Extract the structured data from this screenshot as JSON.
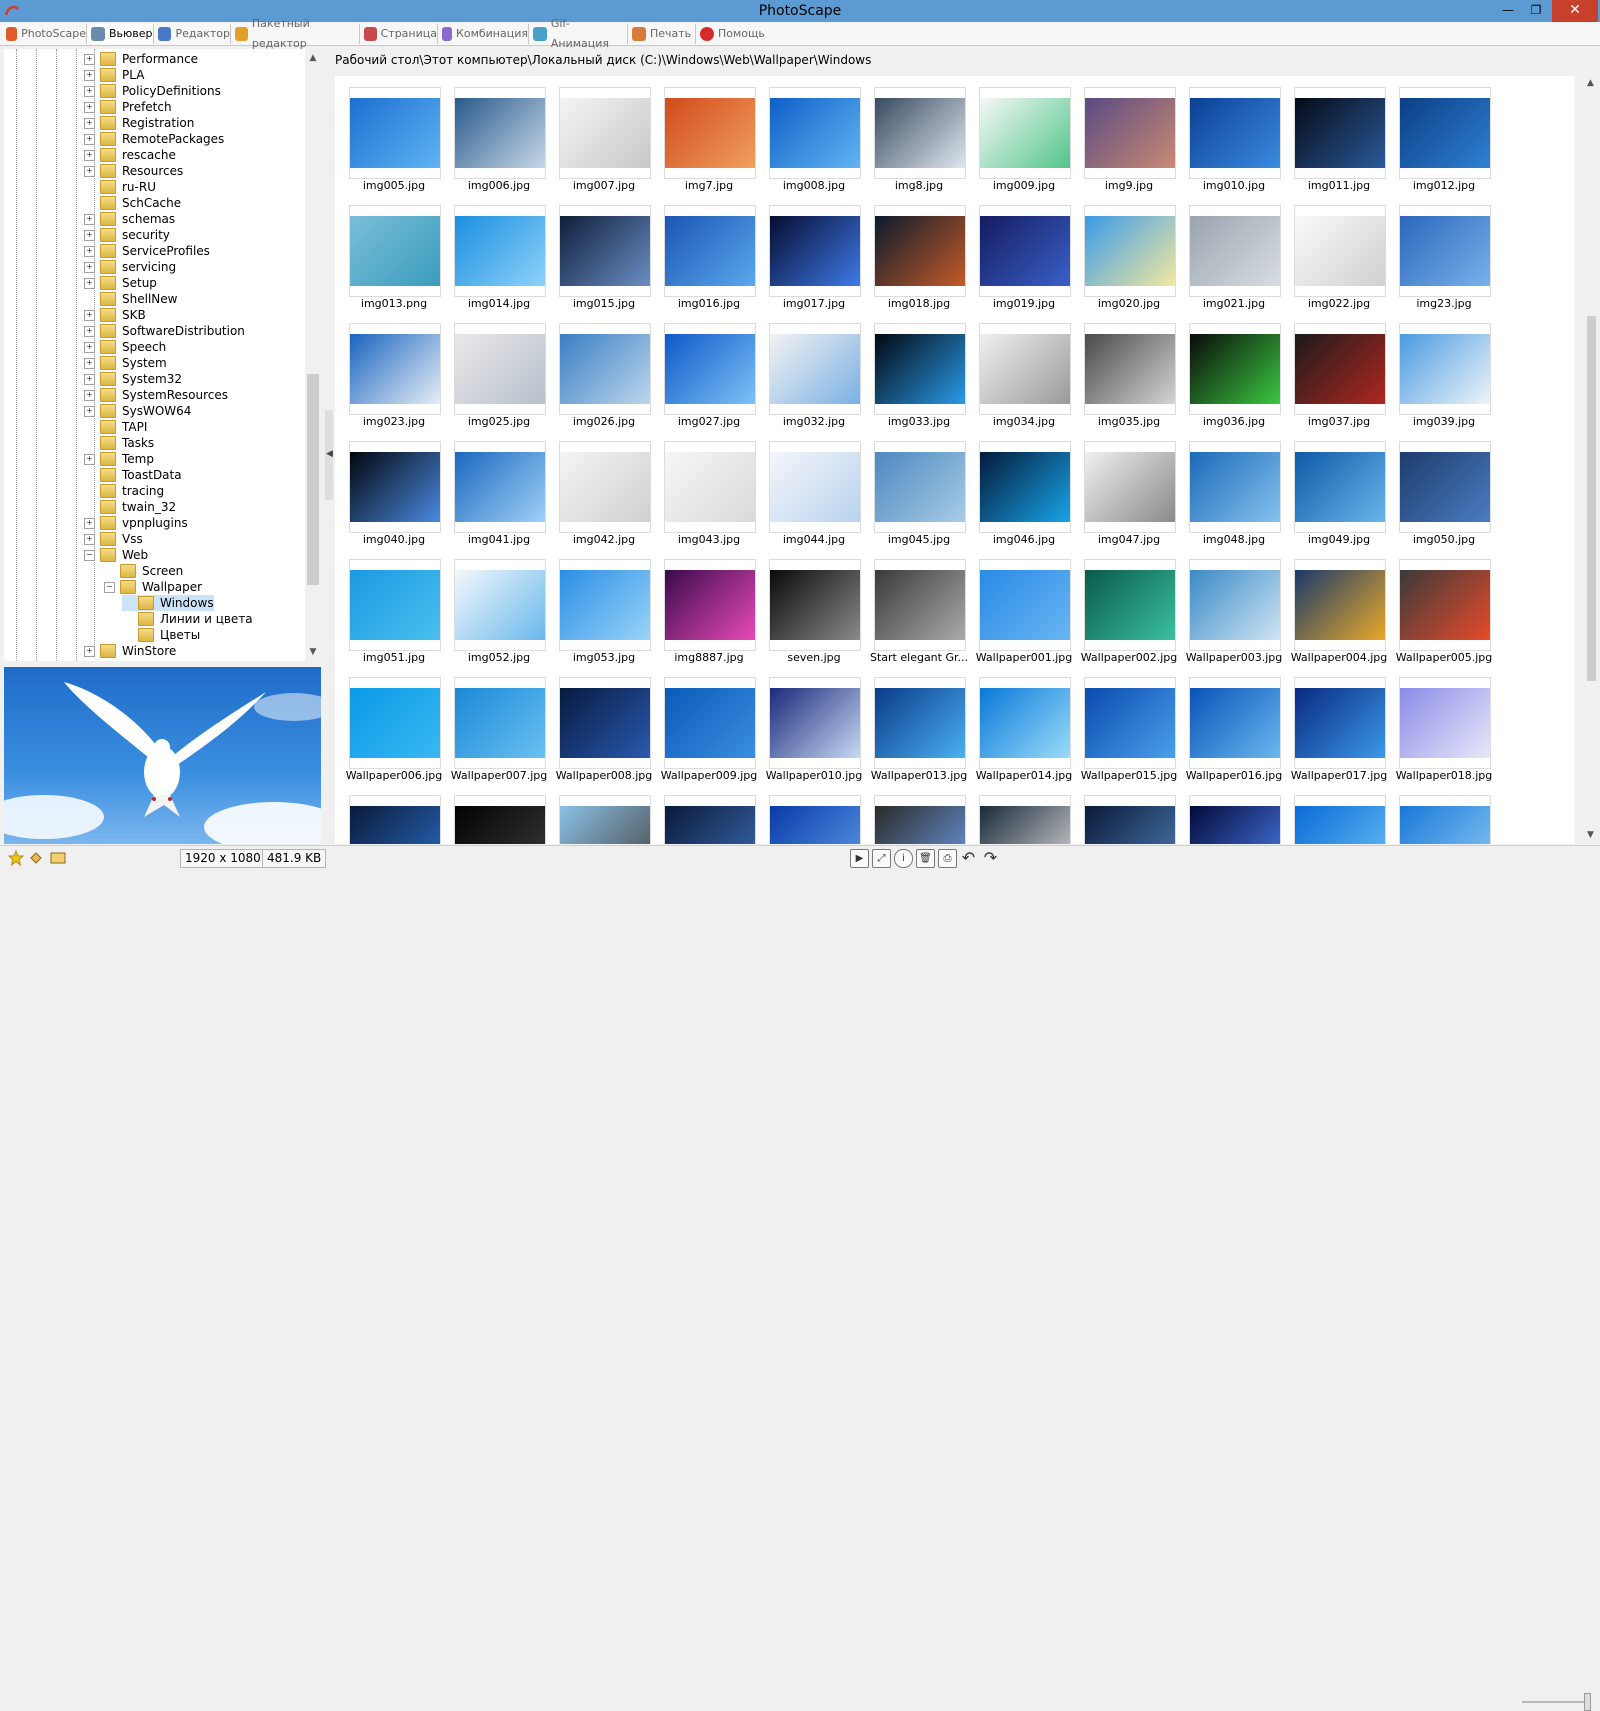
{
  "window": {
    "title": "PhotoScape",
    "minimize": "—",
    "restore": "❐",
    "close": "✕"
  },
  "tabs": [
    {
      "label": "PhotoScape",
      "icon": "photoscape-icon",
      "active": false
    },
    {
      "label": "Вьювер",
      "icon": "viewer-icon",
      "active": true
    },
    {
      "label": "Редактор",
      "icon": "editor-icon",
      "active": false
    },
    {
      "label": "Пакетный редактор",
      "icon": "batch-editor-icon",
      "active": false
    },
    {
      "label": "Страница",
      "icon": "page-icon",
      "active": false
    },
    {
      "label": "Комбинация",
      "icon": "combine-icon",
      "active": false
    },
    {
      "label": "Gif-Анимация",
      "icon": "gif-icon",
      "active": false
    },
    {
      "label": "Печать",
      "icon": "print-icon",
      "active": false
    },
    {
      "label": "Помощь",
      "icon": "help-icon",
      "active": false
    }
  ],
  "tree": {
    "items": [
      {
        "label": "Performance",
        "level": 0,
        "expander": "+"
      },
      {
        "label": "PLA",
        "level": 0,
        "expander": "+"
      },
      {
        "label": "PolicyDefinitions",
        "level": 0,
        "expander": "+"
      },
      {
        "label": "Prefetch",
        "level": 0,
        "expander": "+"
      },
      {
        "label": "Registration",
        "level": 0,
        "expander": "+"
      },
      {
        "label": "RemotePackages",
        "level": 0,
        "expander": "+"
      },
      {
        "label": "rescache",
        "level": 0,
        "expander": "+"
      },
      {
        "label": "Resources",
        "level": 0,
        "expander": "+"
      },
      {
        "label": "ru-RU",
        "level": 0,
        "expander": ""
      },
      {
        "label": "SchCache",
        "level": 0,
        "expander": ""
      },
      {
        "label": "schemas",
        "level": 0,
        "expander": "+"
      },
      {
        "label": "security",
        "level": 0,
        "expander": "+"
      },
      {
        "label": "ServiceProfiles",
        "level": 0,
        "expander": "+"
      },
      {
        "label": "servicing",
        "level": 0,
        "expander": "+"
      },
      {
        "label": "Setup",
        "level": 0,
        "expander": "+"
      },
      {
        "label": "ShellNew",
        "level": 0,
        "expander": ""
      },
      {
        "label": "SKB",
        "level": 0,
        "expander": "+"
      },
      {
        "label": "SoftwareDistribution",
        "level": 0,
        "expander": "+"
      },
      {
        "label": "Speech",
        "level": 0,
        "expander": "+"
      },
      {
        "label": "System",
        "level": 0,
        "expander": "+"
      },
      {
        "label": "System32",
        "level": 0,
        "expander": "+"
      },
      {
        "label": "SystemResources",
        "level": 0,
        "expander": "+"
      },
      {
        "label": "SysWOW64",
        "level": 0,
        "expander": "+"
      },
      {
        "label": "TAPI",
        "level": 0,
        "expander": ""
      },
      {
        "label": "Tasks",
        "level": 0,
        "expander": ""
      },
      {
        "label": "Temp",
        "level": 0,
        "expander": "+"
      },
      {
        "label": "ToastData",
        "level": 0,
        "expander": ""
      },
      {
        "label": "tracing",
        "level": 0,
        "expander": ""
      },
      {
        "label": "twain_32",
        "level": 0,
        "expander": ""
      },
      {
        "label": "vpnplugins",
        "level": 0,
        "expander": "+"
      },
      {
        "label": "Vss",
        "level": 0,
        "expander": "+"
      },
      {
        "label": "Web",
        "level": 0,
        "expander": "−"
      },
      {
        "label": "Screen",
        "level": 1,
        "expander": ""
      },
      {
        "label": "Wallpaper",
        "level": 1,
        "expander": "−"
      },
      {
        "label": "Windows",
        "level": 2,
        "expander": "",
        "selected": true
      },
      {
        "label": "Линии и цвета",
        "level": 2,
        "expander": ""
      },
      {
        "label": "Цветы",
        "level": 2,
        "expander": ""
      },
      {
        "label": "WinStore",
        "level": 0,
        "expander": "+"
      }
    ]
  },
  "path": "Рабочий стол\\Этот компьютер\\Локальный диск (C:)\\Windows\\Web\\Wallpaper\\Windows",
  "thumbnails": [
    {
      "name": "img005.jpg",
      "c1": "#1b6fd0",
      "c2": "#5fb4f4"
    },
    {
      "name": "img006.jpg",
      "c1": "#2a5a8c",
      "c2": "#c7d8e8"
    },
    {
      "name": "img007.jpg",
      "c1": "#f4f4f4",
      "c2": "#c8c8c8"
    },
    {
      "name": "img7.jpg",
      "c1": "#d24a1c",
      "c2": "#f0a060"
    },
    {
      "name": "img008.jpg",
      "c1": "#0e5fc8",
      "c2": "#62b5f2"
    },
    {
      "name": "img8.jpg",
      "c1": "#394a60",
      "c2": "#dfe7ee"
    },
    {
      "name": "img009.jpg",
      "c1": "#f5f8f6",
      "c2": "#52c58a"
    },
    {
      "name": "img9.jpg",
      "c1": "#5a4a82",
      "c2": "#c98a74"
    },
    {
      "name": "img010.jpg",
      "c1": "#0a3f94",
      "c2": "#3a8be0"
    },
    {
      "name": "img011.jpg",
      "c1": "#050a16",
      "c2": "#2a5a9a"
    },
    {
      "name": "img012.jpg",
      "c1": "#0b3e86",
      "c2": "#2f80d2"
    },
    {
      "name": "img013.png",
      "c1": "#79bed8",
      "c2": "#3a9cbc"
    },
    {
      "name": "img014.jpg",
      "c1": "#1a8fe0",
      "c2": "#8fd2fa"
    },
    {
      "name": "img015.jpg",
      "c1": "#0e1e3a",
      "c2": "#6a8ec4"
    },
    {
      "name": "img016.jpg",
      "c1": "#1b55b4",
      "c2": "#5aa8ec"
    },
    {
      "name": "img017.jpg",
      "c1": "#050c30",
      "c2": "#3f7ae8"
    },
    {
      "name": "img018.jpg",
      "c1": "#0b1a2c",
      "c2": "#c45a28"
    },
    {
      "name": "img019.jpg",
      "c1": "#141c60",
      "c2": "#3a60c8"
    },
    {
      "name": "img020.jpg",
      "c1": "#3a9ae8",
      "c2": "#f2e8a0"
    },
    {
      "name": "img021.jpg",
      "c1": "#9aa4ae",
      "c2": "#d8dde2"
    },
    {
      "name": "img022.jpg",
      "c1": "#fafafa",
      "c2": "#d0d0d0"
    },
    {
      "name": "img23.jpg",
      "c1": "#2a66bc",
      "c2": "#7ab2ea"
    },
    {
      "name": "img023.jpg",
      "c1": "#1a64c0",
      "c2": "#e6eef6"
    },
    {
      "name": "img025.jpg",
      "c1": "#e8e8e8",
      "c2": "#b8c0cc"
    },
    {
      "name": "img026.jpg",
      "c1": "#3a7ec4",
      "c2": "#bcd6ec"
    },
    {
      "name": "img027.jpg",
      "c1": "#0d58c8",
      "c2": "#7ec2f6"
    },
    {
      "name": "img032.jpg",
      "c1": "#f2f2f2",
      "c2": "#7ab0e4"
    },
    {
      "name": "img033.jpg",
      "c1": "#020812",
      "c2": "#2a9ae8"
    },
    {
      "name": "img034.jpg",
      "c1": "#f0f0f0",
      "c2": "#9a9a9a"
    },
    {
      "name": "img035.jpg",
      "c1": "#4a4a4a",
      "c2": "#d4d4d4"
    },
    {
      "name": "img036.jpg",
      "c1": "#0a0a0a",
      "c2": "#3ac840"
    },
    {
      "name": "img037.jpg",
      "c1": "#1a1a1a",
      "c2": "#b02820"
    },
    {
      "name": "img039.jpg",
      "c1": "#4a9ae0",
      "c2": "#eef4fa"
    },
    {
      "name": "img040.jpg",
      "c1": "#02060e",
      "c2": "#4a8ae0"
    },
    {
      "name": "img041.jpg",
      "c1": "#1a68c0",
      "c2": "#a0d0f6"
    },
    {
      "name": "img042.jpg",
      "c1": "#f4f4f4",
      "c2": "#d0d0d0"
    },
    {
      "name": "img043.jpg",
      "c1": "#f6f6f6",
      "c2": "#dadada"
    },
    {
      "name": "img044.jpg",
      "c1": "#f4f6fa",
      "c2": "#b8d2ee"
    },
    {
      "name": "img045.jpg",
      "c1": "#4c88c0",
      "c2": "#a8cce6"
    },
    {
      "name": "img046.jpg",
      "c1": "#041a3a",
      "c2": "#18a4e8"
    },
    {
      "name": "img047.jpg",
      "c1": "#f0f0f0",
      "c2": "#8a8a8a"
    },
    {
      "name": "img048.jpg",
      "c1": "#1a6ab8",
      "c2": "#86c2ee"
    },
    {
      "name": "img049.jpg",
      "c1": "#0e5aa8",
      "c2": "#6ab4ea"
    },
    {
      "name": "img050.jpg",
      "c1": "#1e3c6c",
      "c2": "#4a7cc0"
    },
    {
      "name": "img051.jpg",
      "c1": "#1a9ae0",
      "c2": "#4ac0f0"
    },
    {
      "name": "img052.jpg",
      "c1": "#f2f8fc",
      "c2": "#6ab8ec"
    },
    {
      "name": "img053.jpg",
      "c1": "#2a8ee6",
      "c2": "#9ad4f8"
    },
    {
      "name": "img8887.jpg",
      "c1": "#3a0a4a",
      "c2": "#e84ab8"
    },
    {
      "name": "seven.jpg",
      "c1": "#0a0a0a",
      "c2": "#8a8a8a"
    },
    {
      "name": "Start elegant Gr...",
      "c1": "#3a3a3a",
      "c2": "#aaaaaa"
    },
    {
      "name": "Wallpaper001.jpg",
      "c1": "#2a8ae6",
      "c2": "#68b6f2"
    },
    {
      "name": "Wallpaper002.jpg",
      "c1": "#0a5a4a",
      "c2": "#3ac0a0"
    },
    {
      "name": "Wallpaper003.jpg",
      "c1": "#3a8ac8",
      "c2": "#cfe4f2"
    },
    {
      "name": "Wallpaper004.jpg",
      "c1": "#1a3a6a",
      "c2": "#e8a82a"
    },
    {
      "name": "Wallpaper005.jpg",
      "c1": "#3a3a3a",
      "c2": "#e84a2a"
    },
    {
      "name": "Wallpaper006.jpg",
      "c1": "#0a9ae6",
      "c2": "#3ab8f2"
    },
    {
      "name": "Wallpaper007.jpg",
      "c1": "#1a88d8",
      "c2": "#6ac0f0"
    },
    {
      "name": "Wallpaper008.jpg",
      "c1": "#071a40",
      "c2": "#2a5ab0"
    },
    {
      "name": "Wallpaper009.jpg",
      "c1": "#0a5ab8",
      "c2": "#3a8ee0"
    },
    {
      "name": "Wallpaper010.jpg",
      "c1": "#1a2a7a",
      "c2": "#c8d8f4"
    },
    {
      "name": "Wallpaper013.jpg",
      "c1": "#0a3a8a",
      "c2": "#4ab0f0"
    },
    {
      "name": "Wallpaper014.jpg",
      "c1": "#0a78d8",
      "c2": "#9adcfa"
    },
    {
      "name": "Wallpaper015.jpg",
      "c1": "#0a4ab0",
      "c2": "#4aa0ea"
    },
    {
      "name": "Wallpaper016.jpg",
      "c1": "#0a52b8",
      "c2": "#6ab8f0"
    },
    {
      "name": "Wallpaper017.jpg",
      "c1": "#0a2a80",
      "c2": "#3a98e8"
    },
    {
      "name": "Wallpaper018.jpg",
      "c1": "#8a8ae8",
      "c2": "#e8e8f8"
    },
    {
      "name": "",
      "c1": "#0a1a3a",
      "c2": "#2a6ac0"
    },
    {
      "name": "",
      "c1": "#020202",
      "c2": "#3a3a3a"
    },
    {
      "name": "",
      "c1": "#8ac0e6",
      "c2": "#4a4a4a"
    },
    {
      "name": "",
      "c1": "#0a1a3a",
      "c2": "#3a6ab0"
    },
    {
      "name": "",
      "c1": "#0a3aa8",
      "c2": "#5a9ae8"
    },
    {
      "name": "",
      "c1": "#2a2a2a",
      "c2": "#6a9ae0"
    },
    {
      "name": "",
      "c1": "#1a2a3a",
      "c2": "#d8d8d8"
    },
    {
      "name": "",
      "c1": "#0a1a3a",
      "c2": "#4a7ab0"
    },
    {
      "name": "",
      "c1": "#020a3a",
      "c2": "#4a7ae8"
    },
    {
      "name": "",
      "c1": "#0a6ad8",
      "c2": "#6ac0f4"
    },
    {
      "name": "",
      "c1": "#1a78d8",
      "c2": "#8ac8f4"
    }
  ],
  "status": {
    "dimensions": "1920 x 1080",
    "filesize": "481.9 KB"
  },
  "colors": {
    "titlebar": "#5c9ad4",
    "close": "#c7402b",
    "selection": "#cce4f7"
  }
}
